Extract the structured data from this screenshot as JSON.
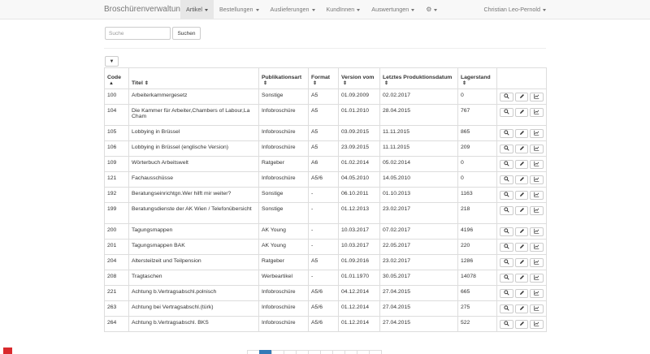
{
  "app": {
    "brand": "Broschürenverwaltung"
  },
  "nav": [
    {
      "label": "Artikel",
      "active": true
    },
    {
      "label": "Bestellungen",
      "active": false
    },
    {
      "label": "Auslieferungen",
      "active": false
    },
    {
      "label": "KundInnen",
      "active": false
    },
    {
      "label": "Auswertungen",
      "active": false
    }
  ],
  "settings_icon": "gear-icon",
  "user": {
    "name": "Christian Leo-Pernold"
  },
  "search": {
    "placeholder": "Suche",
    "button": "Suchen"
  },
  "filter_icon": "filter-icon",
  "table": {
    "columns": [
      "Code",
      "Titel",
      "Publikationsart",
      "Format",
      "Version vom",
      "Letztes Produktionsdatum",
      "Lagerstand"
    ],
    "row_actions": [
      "search-icon",
      "pencil-icon",
      "chart-icon"
    ],
    "rows": [
      {
        "code": "100",
        "title": "Arbeiterkammergesetz",
        "type": "Sonstige",
        "format": "A5",
        "version": "01.09.2009",
        "production": "02.02.2017",
        "stock": "0"
      },
      {
        "code": "104",
        "title": "Die Kammer für Arbeiter,Chambers of Labour,La Cham",
        "type": "Infobroschüre",
        "format": "A5",
        "version": "01.01.2010",
        "production": "28.04.2015",
        "stock": "767"
      },
      {
        "code": "105",
        "title": "Lobbying in Brüssel",
        "type": "Infobroschüre",
        "format": "A5",
        "version": "03.09.2015",
        "production": "11.11.2015",
        "stock": "865"
      },
      {
        "code": "106",
        "title": "Lobbying in Brüssel (englische Version)",
        "type": "Infobroschüre",
        "format": "A5",
        "version": "23.09.2015",
        "production": "11.11.2015",
        "stock": "209"
      },
      {
        "code": "109",
        "title": "Wörterbuch Arbeitswelt",
        "type": "Ratgeber",
        "format": "A6",
        "version": "01.02.2014",
        "production": "05.02.2014",
        "stock": "0"
      },
      {
        "code": "121",
        "title": "Fachausschüsse",
        "type": "Infobroschüre",
        "format": "A5/6",
        "version": "04.05.2010",
        "production": "14.05.2010",
        "stock": "0"
      },
      {
        "code": "192",
        "title": "Beratungseinrichtgn.Wer hilft mir weiter?",
        "type": "Sonstige",
        "format": "-",
        "version": "06.10.2011",
        "production": "01.10.2013",
        "stock": "1163"
      },
      {
        "code": "199",
        "title": "Beratungsdienste der AK Wien / Telefonübersicht",
        "type": "Sonstige",
        "format": "-",
        "version": "01.12.2013",
        "production": "23.02.2017",
        "stock": "218"
      },
      {
        "code": "200",
        "title": "Tagungsmappen",
        "type": "AK Young",
        "format": "-",
        "version": "10.03.2017",
        "production": "07.02.2017",
        "stock": "4196"
      },
      {
        "code": "201",
        "title": "Tagungsmappen BAK",
        "type": "AK Young",
        "format": "-",
        "version": "10.03.2017",
        "production": "22.05.2017",
        "stock": "220"
      },
      {
        "code": "204",
        "title": "Altersteilzeit und Teilpension",
        "type": "Ratgeber",
        "format": "A5",
        "version": "01.09.2016",
        "production": "23.02.2017",
        "stock": "1286"
      },
      {
        "code": "208",
        "title": "Tragtaschen",
        "type": "Werbeartikel",
        "format": "-",
        "version": "01.01.1970",
        "production": "30.05.2017",
        "stock": "14078"
      },
      {
        "code": "221",
        "title": "Achtung b.Vertragsabschl.polnisch",
        "type": "Infobroschüre",
        "format": "A5/6",
        "version": "04.12.2014",
        "production": "27.04.2015",
        "stock": "665"
      },
      {
        "code": "263",
        "title": "Achtung bei Vertragsabschl.(türk)",
        "type": "Infobroschüre",
        "format": "A5/6",
        "version": "01.12.2014",
        "production": "27.04.2015",
        "stock": "275"
      },
      {
        "code": "264",
        "title": "Achtung b.Vertragsabschl. BKS",
        "type": "Infobroschüre",
        "format": "A5/6",
        "version": "01.12.2014",
        "production": "27.04.2015",
        "stock": "522"
      }
    ]
  },
  "colors": {
    "accent": "#337ab7",
    "navbar_bg": "#f8f8f8",
    "brand_red": "#d9292d"
  }
}
